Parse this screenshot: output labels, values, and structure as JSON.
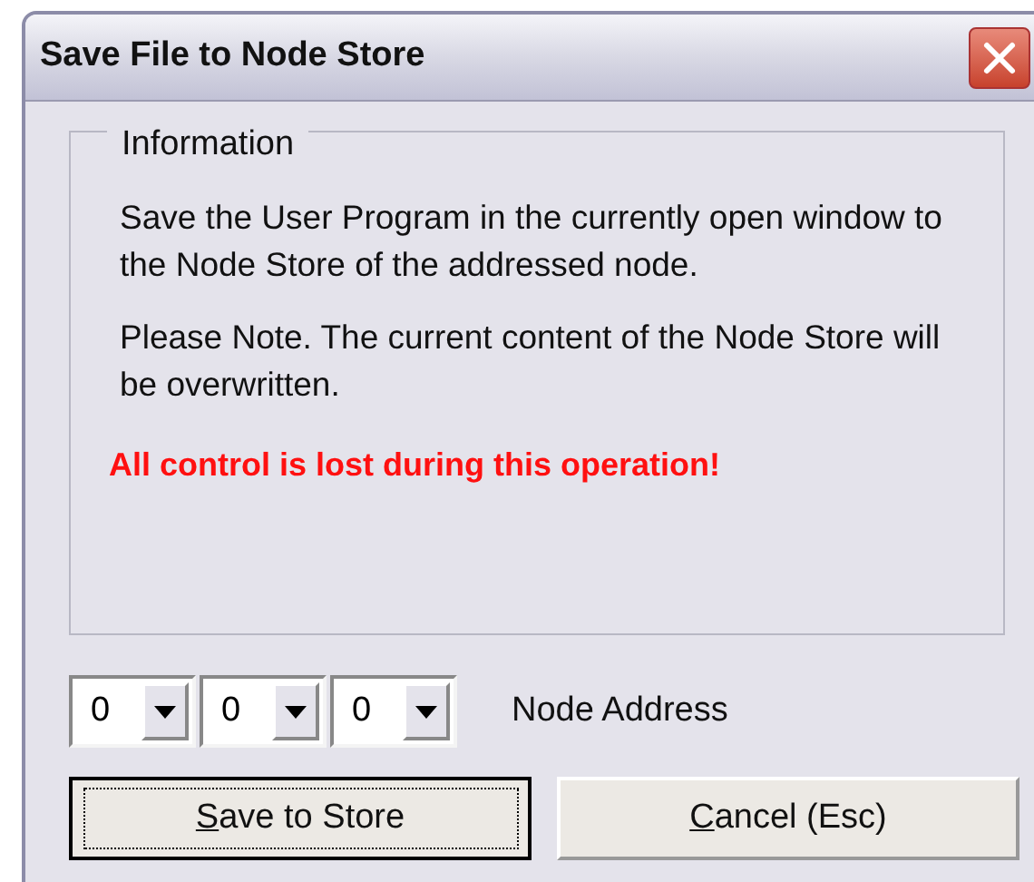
{
  "window": {
    "title": "Save File to Node Store"
  },
  "information": {
    "legend": "Information",
    "paragraphs": [
      {
        "kind": "normal",
        "text": "Save the User Program in the currently open window to the Node Store of the addressed node."
      },
      {
        "kind": "normal",
        "text": "Please Note. The current content of the Node Store will be overwritten."
      },
      {
        "kind": "warning",
        "text": "All control is lost during this operation!"
      }
    ]
  },
  "address": {
    "combos": [
      {
        "value": "0"
      },
      {
        "value": "0"
      },
      {
        "value": "0"
      }
    ],
    "label": "Node Address"
  },
  "buttons": [
    {
      "accel": "S",
      "rest": "ave to Store",
      "default": true
    },
    {
      "accel": "C",
      "rest": "ancel (Esc)",
      "default": false
    }
  ]
}
